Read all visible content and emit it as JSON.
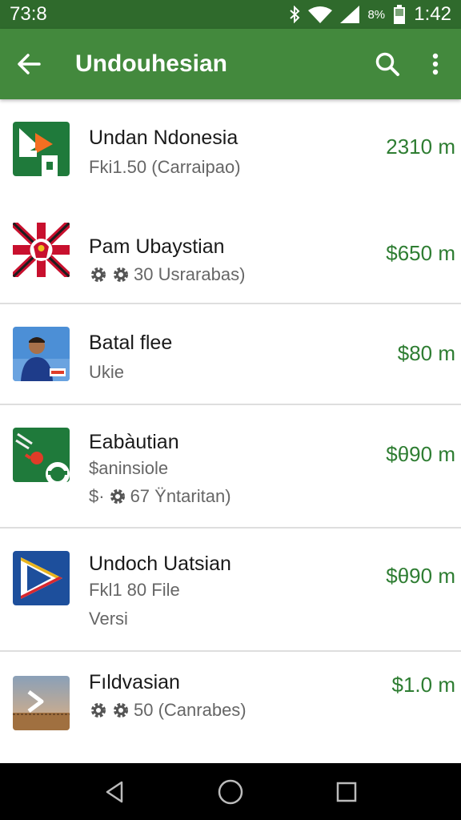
{
  "status_bar": {
    "time_left": "73:8",
    "battery_pct": "8%",
    "time_right": "1:42"
  },
  "app_bar": {
    "title": "Undouhesian",
    "back_icon": "arrow-back-icon",
    "search_icon": "search-icon",
    "menu_icon": "more-vert-icon"
  },
  "items": [
    {
      "title": "Undan Ndonesia",
      "sub1": "Fki1.50 (Carraipao)",
      "price": "2310 m",
      "icon": "green-play-icon"
    },
    {
      "title": "Pam Ubaystian",
      "sub1": "30 Usrarabas)",
      "price": "$650 m",
      "icon": "flag-crest-icon"
    },
    {
      "title": "Batal flee",
      "sub1": "Ukie",
      "price": "$80 m",
      "icon": "person-photo-icon"
    },
    {
      "title": "Eabàutian",
      "sub1": "$aninsiole",
      "sub2_prefix": "$·",
      "sub2": "67 Ÿntaritan)",
      "price": "$θ90 m",
      "icon": "green-gear-icon"
    },
    {
      "title": "Undoch Uatsian",
      "sub1": "Fkl1 80 File",
      "sub2": "Versi",
      "price": "$θ90 m",
      "icon": "blue-play-icon"
    },
    {
      "title": "Fıldvasian",
      "sub1": "50 (Canrabes)",
      "price": "$1.0 m",
      "icon": "landscape-icon"
    }
  ],
  "colors": {
    "status_bar": "#2f6a2c",
    "app_bar": "#43893d",
    "price": "#2e7d32"
  }
}
